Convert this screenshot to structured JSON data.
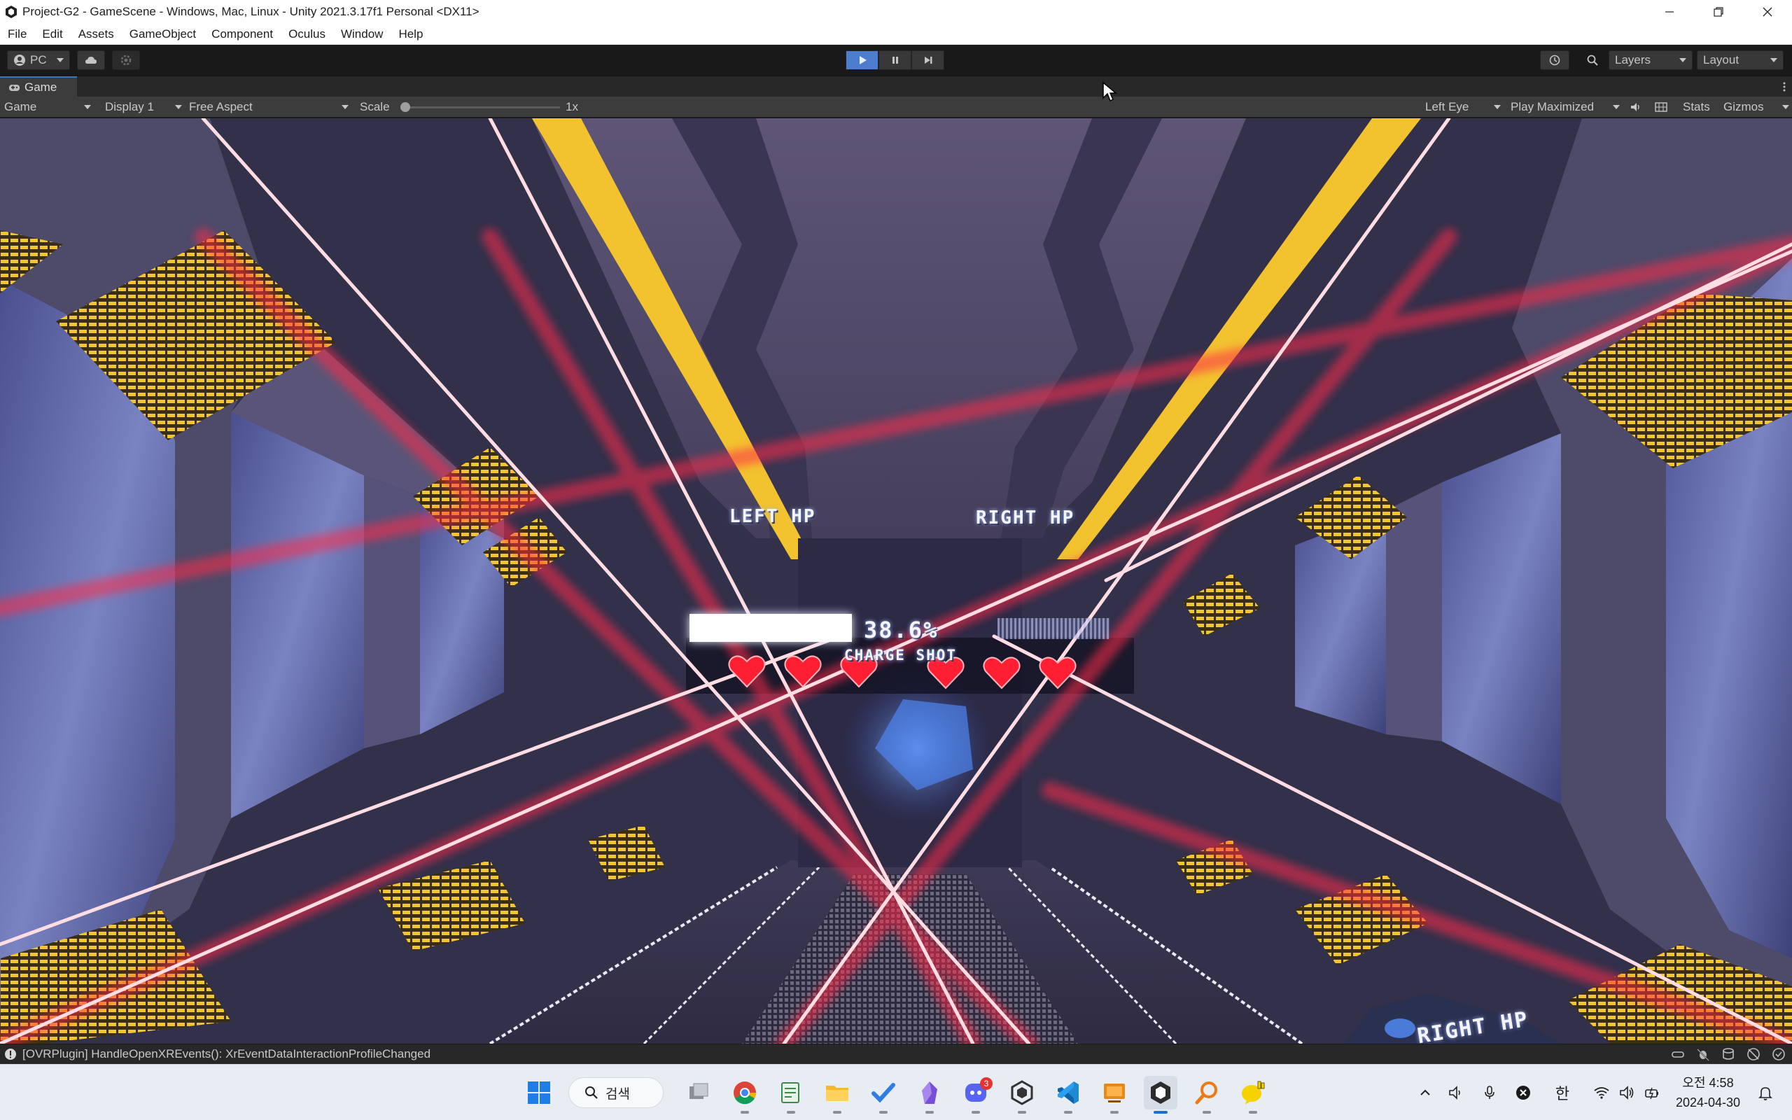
{
  "window": {
    "title": "Project-G2 - GameScene - Windows, Mac, Linux - Unity 2021.3.17f1 Personal <DX11>"
  },
  "menu": [
    "File",
    "Edit",
    "Assets",
    "GameObject",
    "Component",
    "Oculus",
    "Window",
    "Help"
  ],
  "toolbar": {
    "account_label": "PC",
    "play_state": "playing",
    "layers_label": "Layers",
    "layout_label": "Layout"
  },
  "game_view": {
    "tab_label": "Game",
    "view_mode": "Game",
    "display": "Display 1",
    "aspect": "Free Aspect",
    "scale_label": "Scale",
    "scale_value": "1x",
    "eye": "Left Eye",
    "play_mode": "Play Maximized",
    "stats_label": "Stats",
    "gizmos_label": "Gizmos"
  },
  "hud": {
    "left_hp_label": "LEFT HP",
    "right_hp_label": "RIGHT HP",
    "left_hearts": 3,
    "right_hearts": 3,
    "charge_percent_text": "38.6%",
    "charge_fraction": 0.386,
    "charge_label": "CHARGE SHOT",
    "controller_hp_label": "RIGHT HP"
  },
  "console": {
    "message": "[OVRPlugin] HandleOpenXREvents(): XrEventDataInteractionProfileChanged"
  },
  "taskbar": {
    "search_label": "검색",
    "discord_badge": "3",
    "ime_label": "한",
    "time": "오전 4:58",
    "date": "2024-04-30"
  },
  "colors": {
    "unity_dark": "#191919",
    "play_active": "#4c7dcf",
    "laser": "#ff2a4a",
    "heart": "#ff1f33"
  }
}
